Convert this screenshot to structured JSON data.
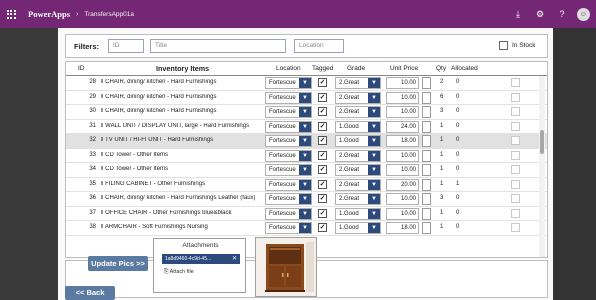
{
  "topbar": {
    "brand": "PowerApps",
    "chevron": "›",
    "app_name": "TransfersApp01a",
    "icons": [
      "download-icon",
      "gear-icon",
      "help-icon"
    ],
    "avatar": "☺"
  },
  "filters": {
    "label": "Filters:",
    "id_placeholder": "ID",
    "title_placeholder": "Title",
    "location_placeholder": "Location",
    "instock_label": "In Stock"
  },
  "table": {
    "headers": {
      "id": "ID",
      "items": "Inventory Items",
      "location": "Location",
      "tagged": "Tagged",
      "grade": "Grade",
      "unit_price": "Unit Price",
      "qty": "Qty",
      "allocated": "Allocated"
    },
    "rows": [
      {
        "id": "28",
        "item": "‖ CHAIR, dining/ kitchen - Hard Furnishings",
        "location": "Fortescue",
        "tagged": true,
        "grade": "2.Great",
        "price": "10.00",
        "qty": "2",
        "allocated": "0",
        "selected": false
      },
      {
        "id": "29",
        "item": "‖ CHAIR, dining/ kitchen - Hard Furnishings",
        "location": "Fortescue",
        "tagged": true,
        "grade": "2.Great",
        "price": "10.00",
        "qty": "6",
        "allocated": "0",
        "selected": false
      },
      {
        "id": "30",
        "item": "‖ CHAIR, dining/ kitchen - Hard Furnishings",
        "location": "Fortescue",
        "tagged": true,
        "grade": "2.Great",
        "price": "10.00",
        "qty": "3",
        "allocated": "0",
        "selected": false
      },
      {
        "id": "31",
        "item": "‖ WALL UNIT / DISPLAY UNIT, large - Hard Furnishings",
        "location": "Fortescue",
        "tagged": true,
        "grade": "1.Good",
        "price": "24.00",
        "qty": "1",
        "allocated": "0",
        "selected": false
      },
      {
        "id": "32",
        "item": "‖ TV UNIT / HI-FI UNIT - Hard Furnishings",
        "location": "Fortescue",
        "tagged": true,
        "grade": "1.Good",
        "price": "18.00",
        "qty": "1",
        "allocated": "0",
        "selected": true
      },
      {
        "id": "33",
        "item": "‖ CD Tower - Other Items",
        "location": "Fortescue",
        "tagged": true,
        "grade": "2.Great",
        "price": "10.00",
        "qty": "1",
        "allocated": "0",
        "selected": false
      },
      {
        "id": "34",
        "item": "‖ CD Tower - Other Items",
        "location": "Fortescue",
        "tagged": true,
        "grade": "2.Great",
        "price": "10.00",
        "qty": "1",
        "allocated": "0",
        "selected": false
      },
      {
        "id": "35",
        "item": "‖ FILING CABINET - Other Furnishings",
        "location": "Fortescue",
        "tagged": true,
        "grade": "2.Great",
        "price": "20.00",
        "qty": "1",
        "allocated": "1",
        "selected": false
      },
      {
        "id": "36",
        "item": "‖ CHAIR, dining/ kitchen - Hard Furnishings Leather (faux)",
        "location": "Fortescue",
        "tagged": true,
        "grade": "2.Great",
        "price": "10.00",
        "qty": "3",
        "allocated": "0",
        "selected": false
      },
      {
        "id": "37",
        "item": "‖ OFFICE CHAIR - Other Furnishings blue&black",
        "location": "Fortescue",
        "tagged": true,
        "grade": "1.Good",
        "price": "10.00",
        "qty": "1",
        "allocated": "0",
        "selected": false
      },
      {
        "id": "38",
        "item": "‖ ARMCHAIR - Soft Furnishings Nursing",
        "location": "Fortescue",
        "tagged": true,
        "grade": "1.Good",
        "price": "18.00",
        "qty": "1",
        "allocated": "0",
        "selected": false
      }
    ]
  },
  "attachments": {
    "title": "Attachments",
    "file_name": "1a8d9460-4c9d-45...",
    "file_remove": "✕",
    "add_label": "Attach file"
  },
  "buttons": {
    "update_pics": "Update Pics >>",
    "back": "<< Back"
  },
  "colors": {
    "topbar": "#742774",
    "accent": "#2c4a7c",
    "button": "#5b7aa1",
    "selected_row": "#e1e1e1"
  }
}
